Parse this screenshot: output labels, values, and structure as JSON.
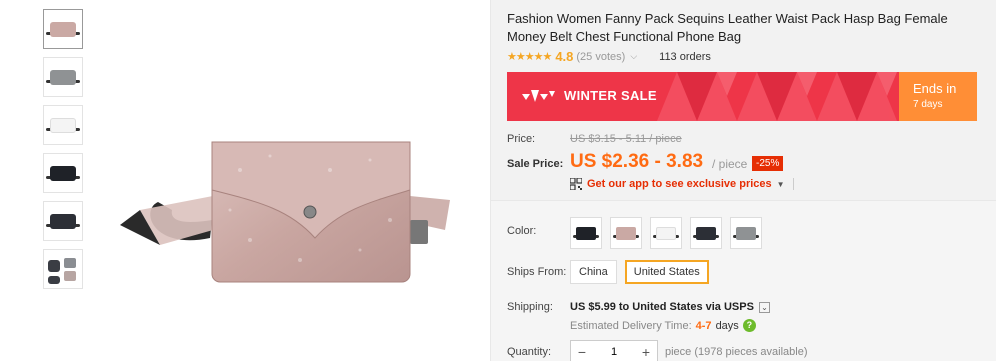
{
  "product": {
    "title": "Fashion Women Fanny Pack Sequins Leather Waist Pack Hasp Bag Female Money Belt Chest Functional Phone Bag",
    "stars": "★★★★★",
    "rating": "4.8",
    "votes": "(25 votes)",
    "orders": "113 orders"
  },
  "promo": {
    "label": "WINTER SALE",
    "ends_label": "Ends in",
    "ends_days": "7 days",
    "brand_color": "#ee3548",
    "accent_color": "#ff8e36"
  },
  "pricing": {
    "price_label": "Price:",
    "old_price": "US $3.15 - 5.11 / piece",
    "sale_label": "Sale Price:",
    "sale_price": "US $2.36 - 3.83",
    "per_unit": "/ piece",
    "discount": "-25%",
    "app_promo": "Get our app to see exclusive prices"
  },
  "options": {
    "color_label": "Color:",
    "colors": [
      "#1f2228",
      "#caa9a4",
      "#f4f4f4",
      "#2c2f36",
      "#8f9294"
    ],
    "ships_label": "Ships From:",
    "ships_from": [
      "China",
      "United States"
    ],
    "ships_selected": "United States",
    "shipping_label": "Shipping:",
    "shipping_price": "US $5.99",
    "shipping_to": "to",
    "shipping_dest": "United States via USPS",
    "est_label": "Estimated Delivery Time:",
    "est_days": "4-7",
    "est_unit": "days",
    "quantity_label": "Quantity:",
    "quantity_value": "1",
    "availability": "piece (1978 pieces available)"
  }
}
